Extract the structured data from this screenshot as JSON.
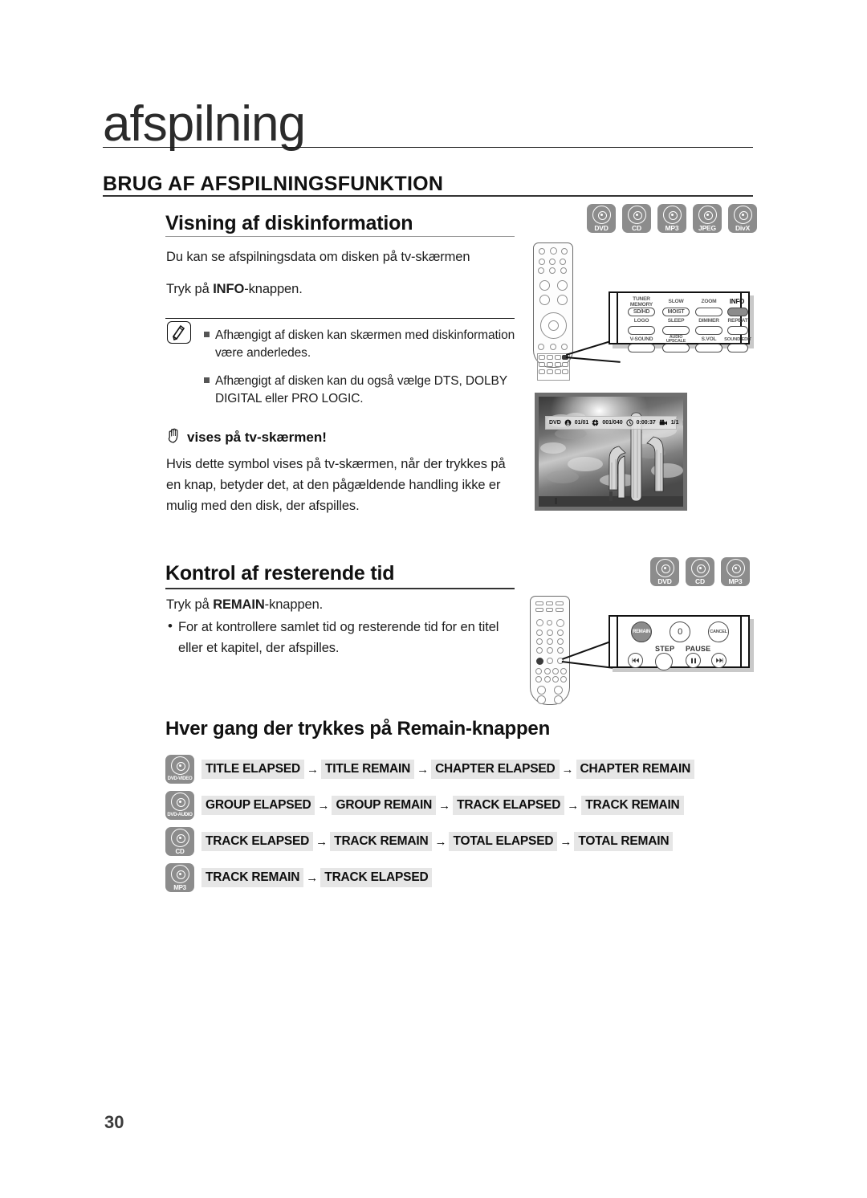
{
  "page": {
    "chapter_title": "afspilning",
    "section_title": "BRUG AF AFSPILNINGSFUNKTION",
    "page_number": "30"
  },
  "section1": {
    "heading": "Visning af diskinformation",
    "line1": "Du kan se afspilningsdata om disken på tv-skærmen",
    "line2_pre": "Tryk på ",
    "line2_bold": "INFO",
    "line2_post": "-knappen.",
    "badges": [
      {
        "label": "DVD"
      },
      {
        "label": "CD"
      },
      {
        "label": "MP3"
      },
      {
        "label": "JPEG"
      },
      {
        "label": "DivX"
      }
    ],
    "note_icon": "memo-pencil-icon",
    "notes": [
      "Afhængigt af disken kan skærmen med diskinformation være anderledes.",
      "Afhængigt af disken kan du også vælge DTS, DOLBY DIGITAL eller PRO LOGIC."
    ],
    "hand_icon": "raised-hand-icon",
    "hand_heading": "vises på tv-skærmen!",
    "hand_body": "Hvis dette symbol vises på tv-skærmen, når der trykkes på en knap, betyder det, at den pågældende handling ikke er mulig med den disk, der afspilles."
  },
  "tv_osd": {
    "disc_type": "DVD",
    "title_icon": "title-icon",
    "title_value": "01/01",
    "chapter_icon": "chapter-icon",
    "chapter_value": "001/040",
    "clock_icon": "clock-icon",
    "time_value": "0:00:37",
    "angle_icon": "camera-angle-icon",
    "angle_value": "1/1",
    "play_icon": "play-icon"
  },
  "callout1": {
    "name": "remote-info-button-callout",
    "rows": [
      [
        {
          "label": "TUNER\nMEMORY",
          "key": "SD/HD",
          "shape": "pill",
          "highlight": false
        },
        {
          "label": "SLOW",
          "key": "MOIST",
          "shape": "pill",
          "highlight": false
        },
        {
          "label": "ZOOM",
          "key": "",
          "shape": "pill",
          "highlight": false
        },
        {
          "label": "INFO",
          "key": "",
          "shape": "pill",
          "highlight": true
        }
      ],
      [
        {
          "label": "LOGO",
          "key": "",
          "shape": "pill",
          "highlight": false
        },
        {
          "label": "SLEEP",
          "key": "",
          "shape": "pill",
          "highlight": false
        },
        {
          "label": "DIMMER",
          "key": "",
          "shape": "pill",
          "highlight": false
        },
        {
          "label": "REPEAT",
          "key": "",
          "shape": "pill",
          "highlight": false
        }
      ],
      [
        {
          "label": "V-SOUND",
          "key": "",
          "shape": "pill",
          "highlight": false
        },
        {
          "label": "AUDIO\nUPSCALE",
          "key": "",
          "shape": "pill",
          "highlight": false
        },
        {
          "label": "S.VOL",
          "key": "",
          "shape": "pill",
          "highlight": false
        },
        {
          "label": "SOUND EDIT",
          "key": "",
          "shape": "pill",
          "highlight": false
        }
      ]
    ]
  },
  "section2": {
    "heading": "Kontrol af resterende tid",
    "line1_pre": "Tryk på ",
    "line1_bold": "REMAIN",
    "line1_post": "-knappen.",
    "bullet": "For at kontrollere samlet tid og resterende tid for en titel eller et kapitel, der afspilles.",
    "badges": [
      {
        "label": "DVD"
      },
      {
        "label": "CD"
      },
      {
        "label": "MP3"
      }
    ]
  },
  "callout2": {
    "name": "remote-remain-button-callout",
    "top_buttons": [
      {
        "label": "REMAIN",
        "highlight": true
      },
      {
        "label": "0",
        "highlight": false
      },
      {
        "label": "CANCEL",
        "highlight": false
      }
    ],
    "mid_labels": [
      "STEP",
      "PAUSE"
    ],
    "bottom_buttons": [
      {
        "icon": "skip-back-icon",
        "glyph": "◄◄"
      },
      {
        "icon": "step-icon",
        "glyph": ""
      },
      {
        "icon": "pause-icon",
        "glyph": "❚❚"
      },
      {
        "icon": "skip-forward-icon",
        "glyph": "►►"
      }
    ]
  },
  "section3": {
    "heading": "Hver gang der trykkes på Remain-knappen",
    "rows": [
      {
        "badge": "DVD-VIDEO",
        "steps": [
          "TITLE ELAPSED",
          "TITLE REMAIN",
          "CHAPTER ELAPSED",
          "CHAPTER REMAIN"
        ]
      },
      {
        "badge": "DVD-AUDIO",
        "steps": [
          "GROUP ELAPSED",
          "GROUP REMAIN",
          "TRACK ELAPSED",
          "TRACK REMAIN"
        ]
      },
      {
        "badge": "CD",
        "steps": [
          "TRACK ELAPSED",
          "TRACK REMAIN",
          "TOTAL ELAPSED",
          "TOTAL REMAIN"
        ]
      },
      {
        "badge": "MP3",
        "steps": [
          "TRACK REMAIN",
          "TRACK ELAPSED"
        ]
      }
    ],
    "arrow": "→"
  },
  "colors": {
    "badge_gray": "#8c8c8c",
    "chip_gray": "#e6e6e6",
    "highlight_gray": "#8c8c8c",
    "text": "#1a1a1a"
  }
}
